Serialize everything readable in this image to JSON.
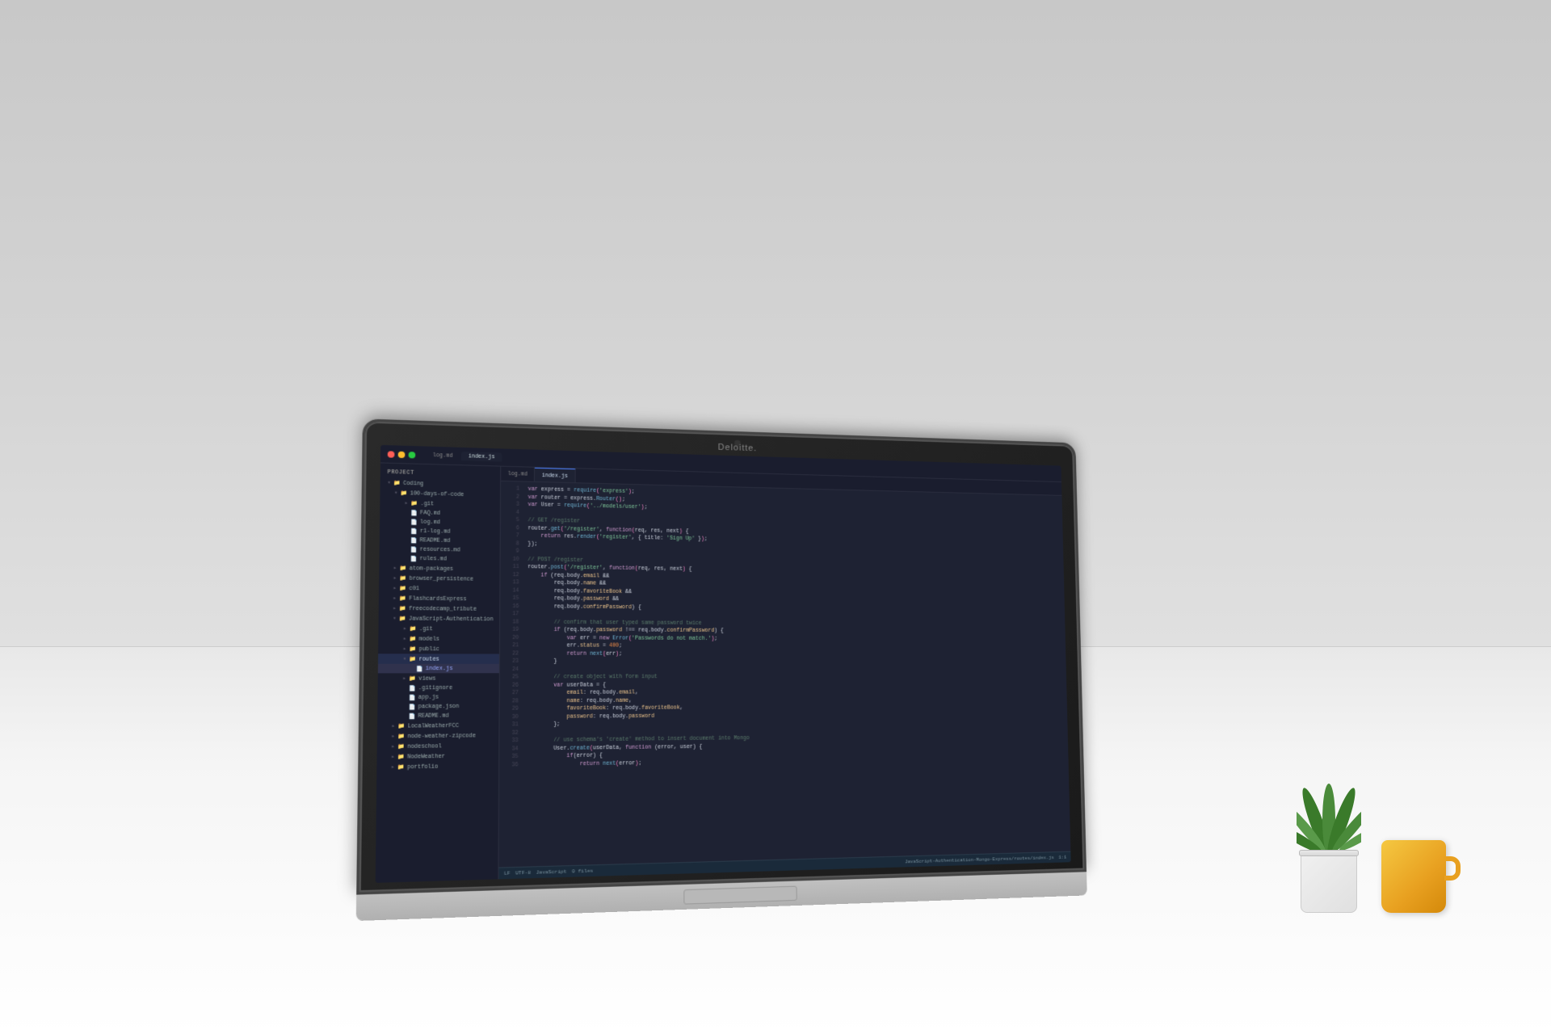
{
  "scene": {
    "brand": "Deloitte.",
    "description": "Laptop on desk with code editor open"
  },
  "ide": {
    "title": "Project",
    "active_file": "index.js",
    "tabs": [
      {
        "label": "log.md",
        "active": false
      },
      {
        "label": "index.js",
        "active": true
      }
    ],
    "sidebar": {
      "title": "Project",
      "items": [
        {
          "label": "Coding",
          "depth": 0,
          "type": "folder",
          "expanded": true
        },
        {
          "label": "100-days-of-code",
          "depth": 1,
          "type": "folder",
          "expanded": true
        },
        {
          "label": ".git",
          "depth": 2,
          "type": "folder"
        },
        {
          "label": "FAQ.md",
          "depth": 2,
          "type": "file"
        },
        {
          "label": "log.md",
          "depth": 2,
          "type": "file"
        },
        {
          "label": "r1-log.md",
          "depth": 2,
          "type": "file"
        },
        {
          "label": "README.md",
          "depth": 2,
          "type": "file"
        },
        {
          "label": "resources.md",
          "depth": 2,
          "type": "file"
        },
        {
          "label": "rules.md",
          "depth": 2,
          "type": "file"
        },
        {
          "label": "atom-packages",
          "depth": 1,
          "type": "folder"
        },
        {
          "label": "browser_persistence",
          "depth": 1,
          "type": "folder"
        },
        {
          "label": "c01",
          "depth": 1,
          "type": "folder"
        },
        {
          "label": "FlashcardsExpress",
          "depth": 1,
          "type": "folder"
        },
        {
          "label": "freecodecamp_tribute",
          "depth": 1,
          "type": "folder"
        },
        {
          "label": "JavaScript-Authentication",
          "depth": 1,
          "type": "folder",
          "expanded": true
        },
        {
          "label": ".git",
          "depth": 2,
          "type": "folder"
        },
        {
          "label": "models",
          "depth": 2,
          "type": "folder"
        },
        {
          "label": "public",
          "depth": 2,
          "type": "folder"
        },
        {
          "label": "routes",
          "depth": 2,
          "type": "folder",
          "expanded": true,
          "active": true
        },
        {
          "label": "index.js",
          "depth": 3,
          "type": "file",
          "selected": true
        },
        {
          "label": "views",
          "depth": 2,
          "type": "folder"
        },
        {
          "label": ".gitignore",
          "depth": 2,
          "type": "file"
        },
        {
          "label": "app.js",
          "depth": 2,
          "type": "file"
        },
        {
          "label": "package.json",
          "depth": 2,
          "type": "file"
        },
        {
          "label": "README.md",
          "depth": 2,
          "type": "file"
        },
        {
          "label": "LocalWeatherFCC",
          "depth": 1,
          "type": "folder"
        },
        {
          "label": "node-weather-zipcode",
          "depth": 1,
          "type": "folder"
        },
        {
          "label": "nodeschool",
          "depth": 1,
          "type": "folder"
        },
        {
          "label": "NodeWeather",
          "depth": 1,
          "type": "folder"
        },
        {
          "label": "portfolio",
          "depth": 1,
          "type": "folder"
        }
      ]
    },
    "code_lines": [
      {
        "num": 1,
        "text": "var express = require('express');",
        "tokens": [
          [
            "kw",
            "var"
          ],
          [
            "plain",
            " express = "
          ],
          [
            "fn-name",
            "require"
          ],
          [
            "paren",
            "("
          ],
          [
            "str",
            "'express'"
          ],
          [
            "paren",
            ")"
          ],
          [
            "",
            " ;"
          ]
        ]
      },
      {
        "num": 2,
        "text": "var router = express.Router();",
        "tokens": []
      },
      {
        "num": 3,
        "text": "var User = require('../models/user');",
        "tokens": []
      },
      {
        "num": 4,
        "text": "",
        "tokens": []
      },
      {
        "num": 5,
        "text": "// GET /register",
        "tokens": [
          [
            "cm",
            "// GET /register"
          ]
        ]
      },
      {
        "num": 6,
        "text": "router.get('/register', function(req, res, next) {",
        "tokens": []
      },
      {
        "num": 7,
        "text": "    return res.render('register', { title: 'Sign Up' });",
        "tokens": []
      },
      {
        "num": 8,
        "text": "});",
        "tokens": []
      },
      {
        "num": 9,
        "text": "",
        "tokens": []
      },
      {
        "num": 10,
        "text": "// POST /register",
        "tokens": [
          [
            "cm",
            "// POST /register"
          ]
        ]
      },
      {
        "num": 11,
        "text": "router.post('/register', function(req, res, next) {",
        "tokens": []
      },
      {
        "num": 12,
        "text": "    if (req.body.email &&",
        "tokens": []
      },
      {
        "num": 13,
        "text": "        req.body.name &&",
        "tokens": []
      },
      {
        "num": 14,
        "text": "        req.body.favoriteBook &&",
        "tokens": []
      },
      {
        "num": 15,
        "text": "        req.body.password &&",
        "tokens": []
      },
      {
        "num": 16,
        "text": "        req.body.confirmPassword) {",
        "tokens": []
      },
      {
        "num": 17,
        "text": "",
        "tokens": []
      },
      {
        "num": 18,
        "text": "        // confirm that user typed same password twice",
        "tokens": [
          [
            "cm",
            "        // confirm that user typed same password twice"
          ]
        ]
      },
      {
        "num": 19,
        "text": "        if (req.body.password !== req.body.confirmPassword) {",
        "tokens": []
      },
      {
        "num": 20,
        "text": "            var err = new Error('Passwords do not match.');",
        "tokens": []
      },
      {
        "num": 21,
        "text": "            err.status = 400;",
        "tokens": []
      },
      {
        "num": 22,
        "text": "            return next(err);",
        "tokens": []
      },
      {
        "num": 23,
        "text": "        }",
        "tokens": []
      },
      {
        "num": 24,
        "text": "",
        "tokens": []
      },
      {
        "num": 25,
        "text": "        // create object with form input",
        "tokens": [
          [
            "cm",
            "        // create object with form input"
          ]
        ]
      },
      {
        "num": 26,
        "text": "        var userData = {",
        "tokens": []
      },
      {
        "num": 27,
        "text": "            email: req.body.email,",
        "tokens": []
      },
      {
        "num": 28,
        "text": "            name: req.body.name,",
        "tokens": []
      },
      {
        "num": 29,
        "text": "            favoriteBook: req.body.favoriteBook,",
        "tokens": []
      },
      {
        "num": 30,
        "text": "            password: req.body.password",
        "tokens": []
      },
      {
        "num": 31,
        "text": "        };",
        "tokens": []
      },
      {
        "num": 32,
        "text": "",
        "tokens": []
      },
      {
        "num": 33,
        "text": "        // use schema's 'create' method to insert document into Mongo",
        "tokens": [
          [
            "cm",
            "        // use schema's 'create' method to insert document into Mongo"
          ]
        ]
      },
      {
        "num": 34,
        "text": "        User.create(userData, function (error, user) {",
        "tokens": []
      },
      {
        "num": 35,
        "text": "            if(error) {",
        "tokens": []
      },
      {
        "num": 36,
        "text": "                return next(error);",
        "tokens": []
      }
    ],
    "status_bar": {
      "encoding": "LF",
      "charset": "UTF-8",
      "language": "JavaScript",
      "files": "0 files",
      "path": "JavaScript-Authentication-Mongo-Express/routes/index.js",
      "position": "1:1"
    }
  }
}
